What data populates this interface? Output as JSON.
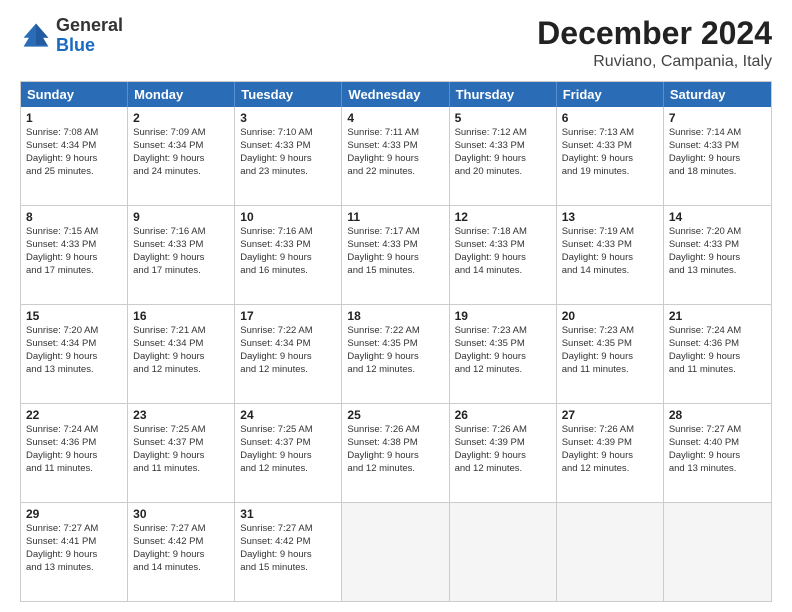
{
  "logo": {
    "general": "General",
    "blue": "Blue"
  },
  "header": {
    "month": "December 2024",
    "location": "Ruviano, Campania, Italy"
  },
  "days": [
    "Sunday",
    "Monday",
    "Tuesday",
    "Wednesday",
    "Thursday",
    "Friday",
    "Saturday"
  ],
  "weeks": [
    [
      {
        "day": "1",
        "sunrise": "Sunrise: 7:08 AM",
        "sunset": "Sunset: 4:34 PM",
        "daylight": "Daylight: 9 hours and 25 minutes."
      },
      {
        "day": "2",
        "sunrise": "Sunrise: 7:09 AM",
        "sunset": "Sunset: 4:34 PM",
        "daylight": "Daylight: 9 hours and 24 minutes."
      },
      {
        "day": "3",
        "sunrise": "Sunrise: 7:10 AM",
        "sunset": "Sunset: 4:33 PM",
        "daylight": "Daylight: 9 hours and 23 minutes."
      },
      {
        "day": "4",
        "sunrise": "Sunrise: 7:11 AM",
        "sunset": "Sunset: 4:33 PM",
        "daylight": "Daylight: 9 hours and 22 minutes."
      },
      {
        "day": "5",
        "sunrise": "Sunrise: 7:12 AM",
        "sunset": "Sunset: 4:33 PM",
        "daylight": "Daylight: 9 hours and 20 minutes."
      },
      {
        "day": "6",
        "sunrise": "Sunrise: 7:13 AM",
        "sunset": "Sunset: 4:33 PM",
        "daylight": "Daylight: 9 hours and 19 minutes."
      },
      {
        "day": "7",
        "sunrise": "Sunrise: 7:14 AM",
        "sunset": "Sunset: 4:33 PM",
        "daylight": "Daylight: 9 hours and 18 minutes."
      }
    ],
    [
      {
        "day": "8",
        "sunrise": "Sunrise: 7:15 AM",
        "sunset": "Sunset: 4:33 PM",
        "daylight": "Daylight: 9 hours and 17 minutes."
      },
      {
        "day": "9",
        "sunrise": "Sunrise: 7:16 AM",
        "sunset": "Sunset: 4:33 PM",
        "daylight": "Daylight: 9 hours and 17 minutes."
      },
      {
        "day": "10",
        "sunrise": "Sunrise: 7:16 AM",
        "sunset": "Sunset: 4:33 PM",
        "daylight": "Daylight: 9 hours and 16 minutes."
      },
      {
        "day": "11",
        "sunrise": "Sunrise: 7:17 AM",
        "sunset": "Sunset: 4:33 PM",
        "daylight": "Daylight: 9 hours and 15 minutes."
      },
      {
        "day": "12",
        "sunrise": "Sunrise: 7:18 AM",
        "sunset": "Sunset: 4:33 PM",
        "daylight": "Daylight: 9 hours and 14 minutes."
      },
      {
        "day": "13",
        "sunrise": "Sunrise: 7:19 AM",
        "sunset": "Sunset: 4:33 PM",
        "daylight": "Daylight: 9 hours and 14 minutes."
      },
      {
        "day": "14",
        "sunrise": "Sunrise: 7:20 AM",
        "sunset": "Sunset: 4:33 PM",
        "daylight": "Daylight: 9 hours and 13 minutes."
      }
    ],
    [
      {
        "day": "15",
        "sunrise": "Sunrise: 7:20 AM",
        "sunset": "Sunset: 4:34 PM",
        "daylight": "Daylight: 9 hours and 13 minutes."
      },
      {
        "day": "16",
        "sunrise": "Sunrise: 7:21 AM",
        "sunset": "Sunset: 4:34 PM",
        "daylight": "Daylight: 9 hours and 12 minutes."
      },
      {
        "day": "17",
        "sunrise": "Sunrise: 7:22 AM",
        "sunset": "Sunset: 4:34 PM",
        "daylight": "Daylight: 9 hours and 12 minutes."
      },
      {
        "day": "18",
        "sunrise": "Sunrise: 7:22 AM",
        "sunset": "Sunset: 4:35 PM",
        "daylight": "Daylight: 9 hours and 12 minutes."
      },
      {
        "day": "19",
        "sunrise": "Sunrise: 7:23 AM",
        "sunset": "Sunset: 4:35 PM",
        "daylight": "Daylight: 9 hours and 12 minutes."
      },
      {
        "day": "20",
        "sunrise": "Sunrise: 7:23 AM",
        "sunset": "Sunset: 4:35 PM",
        "daylight": "Daylight: 9 hours and 11 minutes."
      },
      {
        "day": "21",
        "sunrise": "Sunrise: 7:24 AM",
        "sunset": "Sunset: 4:36 PM",
        "daylight": "Daylight: 9 hours and 11 minutes."
      }
    ],
    [
      {
        "day": "22",
        "sunrise": "Sunrise: 7:24 AM",
        "sunset": "Sunset: 4:36 PM",
        "daylight": "Daylight: 9 hours and 11 minutes."
      },
      {
        "day": "23",
        "sunrise": "Sunrise: 7:25 AM",
        "sunset": "Sunset: 4:37 PM",
        "daylight": "Daylight: 9 hours and 11 minutes."
      },
      {
        "day": "24",
        "sunrise": "Sunrise: 7:25 AM",
        "sunset": "Sunset: 4:37 PM",
        "daylight": "Daylight: 9 hours and 12 minutes."
      },
      {
        "day": "25",
        "sunrise": "Sunrise: 7:26 AM",
        "sunset": "Sunset: 4:38 PM",
        "daylight": "Daylight: 9 hours and 12 minutes."
      },
      {
        "day": "26",
        "sunrise": "Sunrise: 7:26 AM",
        "sunset": "Sunset: 4:39 PM",
        "daylight": "Daylight: 9 hours and 12 minutes."
      },
      {
        "day": "27",
        "sunrise": "Sunrise: 7:26 AM",
        "sunset": "Sunset: 4:39 PM",
        "daylight": "Daylight: 9 hours and 12 minutes."
      },
      {
        "day": "28",
        "sunrise": "Sunrise: 7:27 AM",
        "sunset": "Sunset: 4:40 PM",
        "daylight": "Daylight: 9 hours and 13 minutes."
      }
    ],
    [
      {
        "day": "29",
        "sunrise": "Sunrise: 7:27 AM",
        "sunset": "Sunset: 4:41 PM",
        "daylight": "Daylight: 9 hours and 13 minutes."
      },
      {
        "day": "30",
        "sunrise": "Sunrise: 7:27 AM",
        "sunset": "Sunset: 4:42 PM",
        "daylight": "Daylight: 9 hours and 14 minutes."
      },
      {
        "day": "31",
        "sunrise": "Sunrise: 7:27 AM",
        "sunset": "Sunset: 4:42 PM",
        "daylight": "Daylight: 9 hours and 15 minutes."
      },
      null,
      null,
      null,
      null
    ]
  ]
}
